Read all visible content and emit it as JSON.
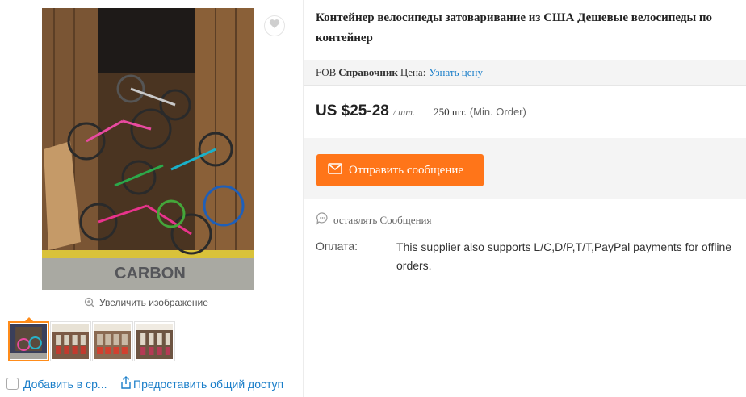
{
  "gallery": {
    "main_image_alt": "bicycles in container",
    "zoom_label": "Увеличить изображение",
    "thumbnails": [
      {
        "name": "thumb-bikes-container",
        "active": true
      },
      {
        "name": "thumb-bikes-rack-1",
        "active": false
      },
      {
        "name": "thumb-bikes-rack-2",
        "active": false
      },
      {
        "name": "thumb-bikes-rack-3",
        "active": false
      }
    ],
    "add_to_compare_label": "Добавить в ср...",
    "share_label": "Предоставить общий доступ",
    "icons": {
      "favorite": "heart-icon",
      "zoom": "zoom-in-icon",
      "share": "share-icon"
    }
  },
  "product": {
    "title": "Контейнер велосипеды затоваривание из США Дешевые велосипеды по контейнер",
    "fob_label": "FOB",
    "reference_label": "Справочник",
    "price_word": "Цена:",
    "get_price_link": "Узнать цену",
    "price": "US $25-28",
    "price_unit": "/ шт.",
    "min_order_qty": "250 шт.",
    "min_order_note": "(Min. Order)",
    "send_message_label": "Отправить сообщение",
    "leave_message_label": "оставлять Сообщения",
    "payment_label": "Оплата:",
    "payment_text": "This supplier also supports L/C,D/P,T/T,PayPal payments for offline orders."
  },
  "colors": {
    "accent_orange": "#ff7519",
    "link_blue": "#1a7ec9",
    "band_gray": "#f4f4f4"
  }
}
